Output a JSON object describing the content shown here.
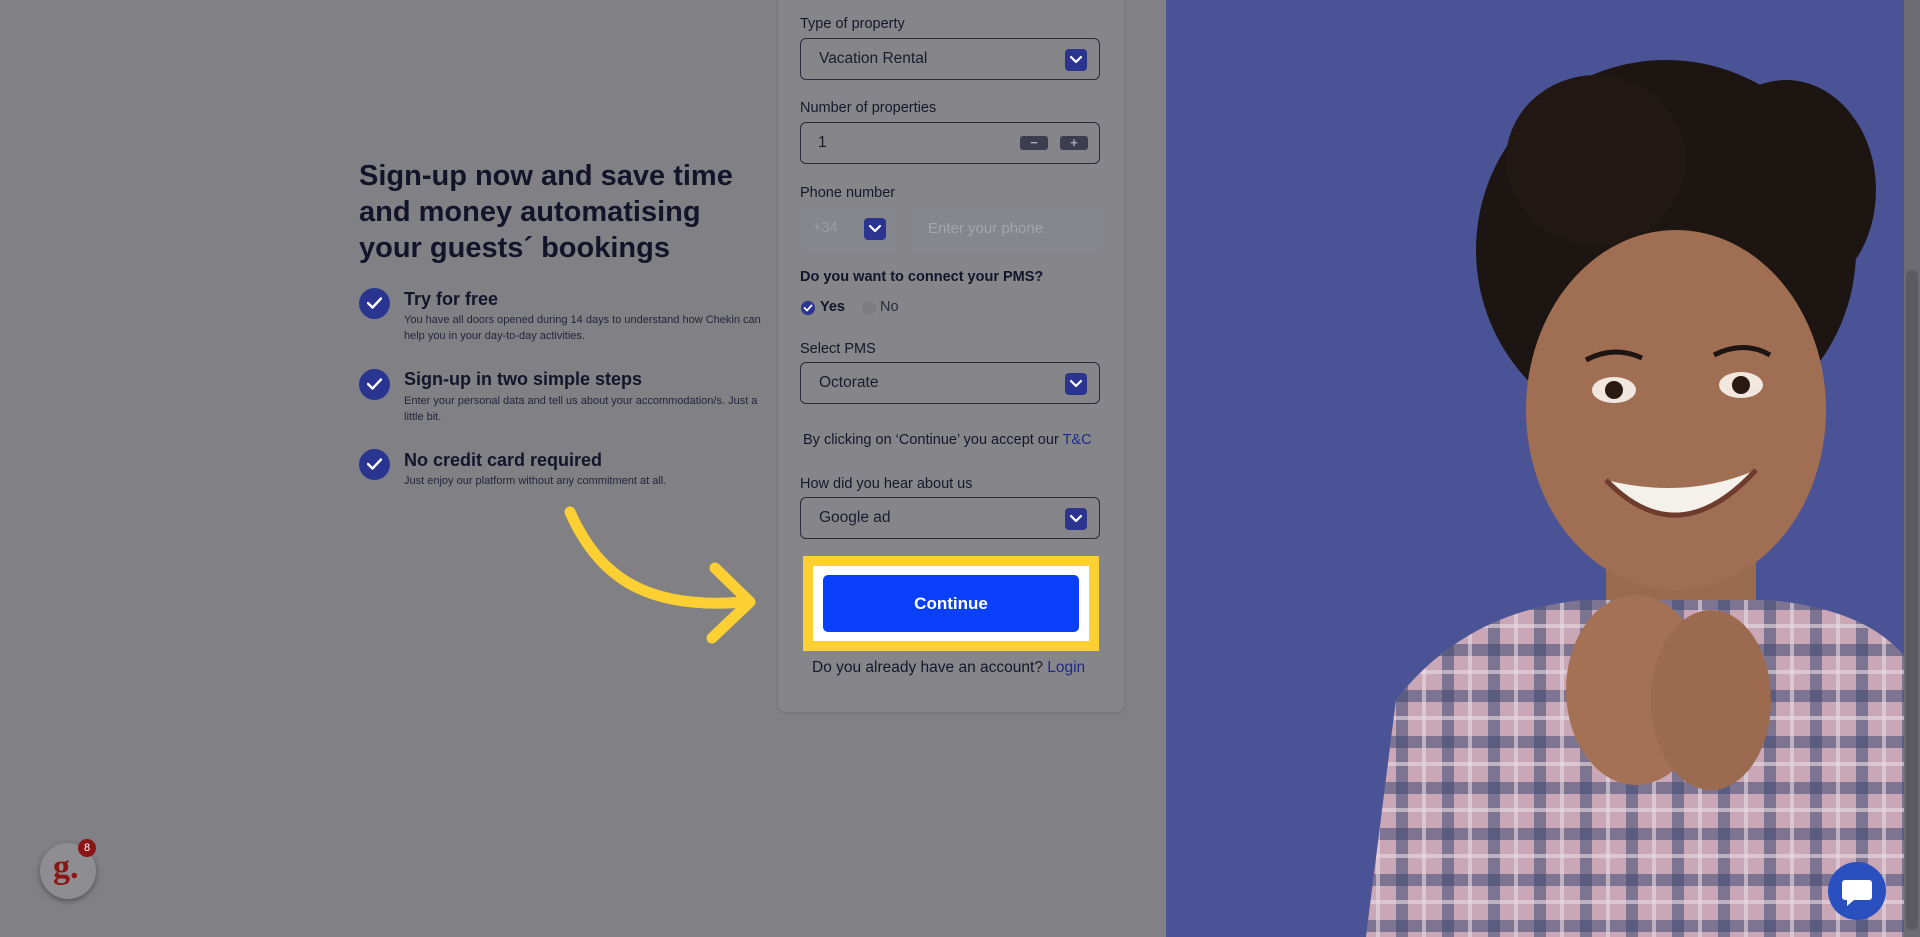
{
  "headline": "Sign-up now and save time and money automatising your guests´ bookings",
  "features": [
    {
      "title": "Try for free",
      "desc": "You have all doors opened during 14 days to understand how Chekin can help you in your day-to-day activities."
    },
    {
      "title": "Sign-up in two simple steps",
      "desc": "Enter your personal data and tell us about your accommodation/s. Just a little bit."
    },
    {
      "title": "No credit card required",
      "desc": "Just enjoy our platform without any commitment at all."
    }
  ],
  "form": {
    "property_type": {
      "label": "Type of property",
      "value": "Vacation Rental"
    },
    "num_properties": {
      "label": "Number of properties",
      "value": "1",
      "minus": "−",
      "plus": "+"
    },
    "phone": {
      "label": "Phone number",
      "code": "+34",
      "placeholder": "Enter your phone"
    },
    "pms_question": {
      "label": "Do you want to connect your PMS?",
      "yes": "Yes",
      "no": "No",
      "selected": "Yes"
    },
    "select_pms": {
      "label": "Select PMS",
      "value": "Octorate"
    },
    "terms": {
      "text": "By clicking on ‘Continue’ you accept our",
      "link": "T&C"
    },
    "hear_about": {
      "label": "How did you hear about us",
      "value": "Google ad"
    },
    "continue_label": "Continue",
    "login": {
      "text": "Do you already have an account?",
      "link": "Login"
    }
  },
  "widget": {
    "badge": "8",
    "logo": "g."
  },
  "colors": {
    "accent_blue": "#0a40fb",
    "highlight_yellow": "#fccf33",
    "dark_navy": "#2a3592",
    "link": "#1f2a8c"
  },
  "icons": {
    "check": "check-icon",
    "chevron": "chevron-down-icon",
    "chat": "chat-bubble-icon",
    "arrow": "curved-arrow-icon"
  }
}
